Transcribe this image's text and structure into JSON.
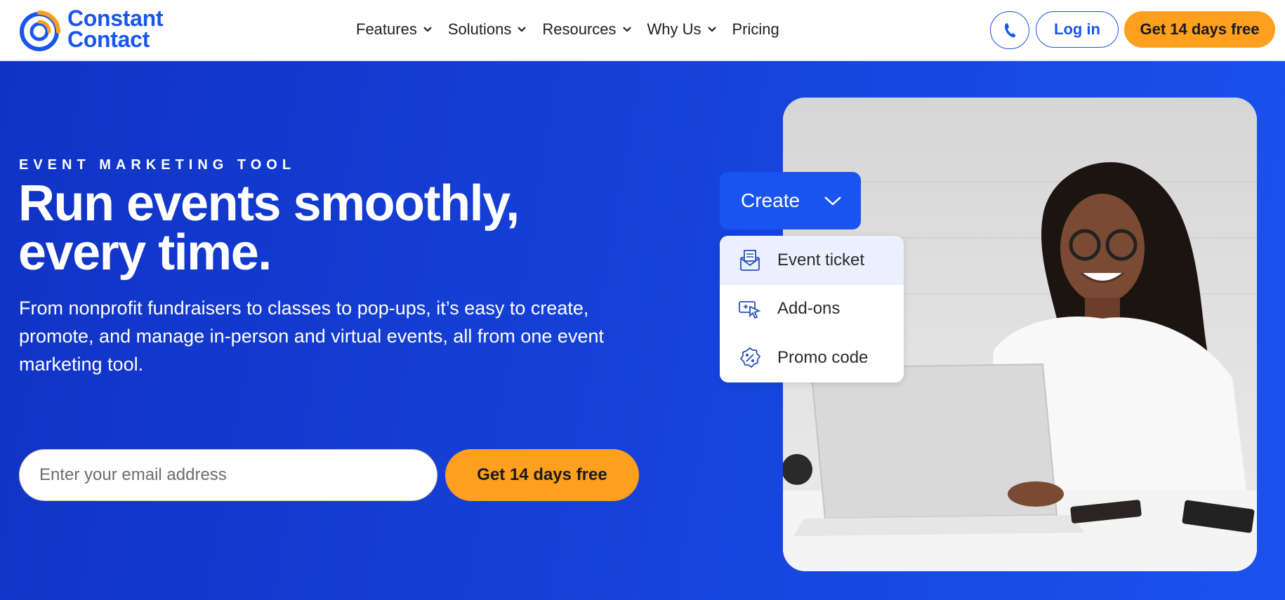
{
  "brand": {
    "line1": "Constant",
    "line2": "Contact"
  },
  "nav": {
    "items": [
      {
        "label": "Features",
        "has_menu": true
      },
      {
        "label": "Solutions",
        "has_menu": true
      },
      {
        "label": "Resources",
        "has_menu": true
      },
      {
        "label": "Why Us",
        "has_menu": true
      },
      {
        "label": "Pricing",
        "has_menu": false
      }
    ],
    "login_label": "Log in",
    "trial_label": "Get 14 days free"
  },
  "hero": {
    "eyebrow": "EVENT MARKETING TOOL",
    "headline_line1": "Run events smoothly,",
    "headline_line2": "every time.",
    "subcopy": "From nonprofit fundraisers to classes to pop-ups, it’s easy to create, promote, and manage in-person and virtual events, all from one event marketing tool.",
    "email_placeholder": "Enter your email address",
    "cta_label": "Get 14 days free"
  },
  "dropdown": {
    "button_label": "Create",
    "items": [
      {
        "label": "Event ticket",
        "icon": "envelope-ticket-icon"
      },
      {
        "label": "Add-ons",
        "icon": "cursor-add-icon"
      },
      {
        "label": "Promo code",
        "icon": "promo-badge-icon"
      }
    ]
  },
  "colors": {
    "brand_blue": "#1856ed",
    "hero_blue": "#1540d8",
    "cta_orange": "#fe9f1e",
    "white": "#ffffff"
  }
}
